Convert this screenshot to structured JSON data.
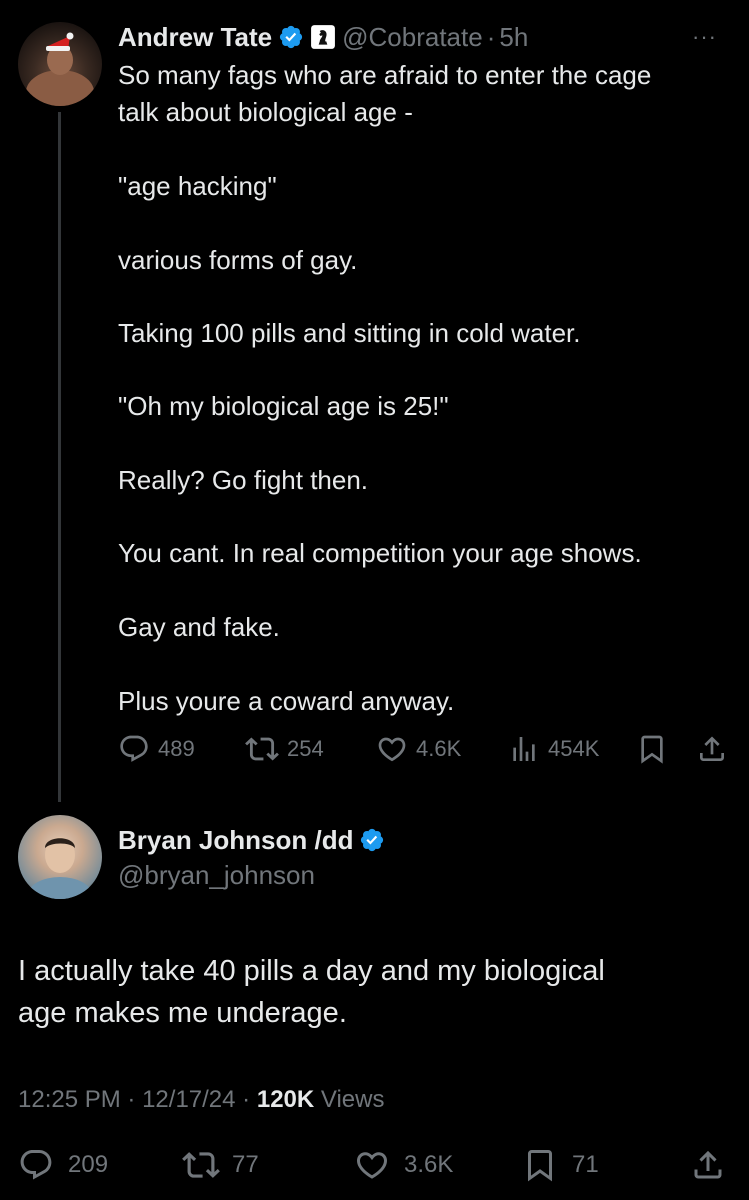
{
  "tweet": {
    "author_name": "Andrew Tate",
    "handle": "@Cobratate",
    "separator": "·",
    "time": "5h",
    "more": "···",
    "lines": [
      "So many fags who are afraid to enter the cage",
      "talk about biological age -",
      "\"age hacking\"",
      "various forms of gay.",
      "Taking 100 pills and sitting in cold water.",
      "\"Oh my biological age is 25!\"",
      "Really? Go fight then.",
      "You cant. In real competition your age shows.",
      "Gay and fake.",
      "Plus youre a coward anyway."
    ],
    "stats": {
      "replies": "489",
      "reposts": "254",
      "likes": "4.6K",
      "views": "454K"
    }
  },
  "reply": {
    "author_name": "Bryan Johnson /dd",
    "handle": "@bryan_johnson",
    "lines": [
      "I actually take 40 pills a day and my biological",
      "age makes me underage."
    ],
    "time": "12:25 PM",
    "date": "12/17/24",
    "views_count": "120K",
    "views_label": "Views",
    "stats": {
      "replies": "209",
      "reposts": "77",
      "likes": "3.6K",
      "bookmarks": "71"
    }
  },
  "colors": {
    "background": "#000000",
    "text": "#e7e9ea",
    "muted": "#71767b",
    "verified": "#1d9bf0",
    "thread_line": "#333639"
  }
}
